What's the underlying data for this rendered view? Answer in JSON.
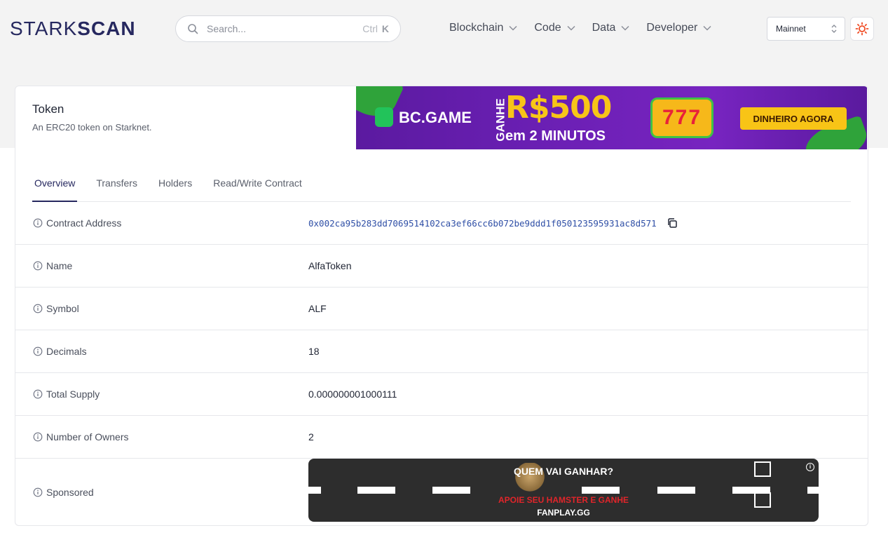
{
  "header": {
    "logo_thin": "STARK",
    "logo_bold": "SCAN",
    "search_placeholder": "Search...",
    "search_shortcut_ctrl": "Ctrl",
    "search_shortcut_key": "K",
    "nav": [
      "Blockchain",
      "Code",
      "Data",
      "Developer"
    ],
    "network": "Mainnet"
  },
  "card": {
    "title": "Token",
    "subtitle": "An ERC20 token on Starknet.",
    "banner": {
      "brand": "BC.GAME",
      "ganhe": "GANHE",
      "amount": "R$500",
      "minutes": "em 2 MINUTOS",
      "slot": "777",
      "cta": "DINHEIRO AGORA"
    },
    "tabs": [
      "Overview",
      "Transfers",
      "Holders",
      "Read/Write Contract"
    ],
    "active_tab": "Overview",
    "rows": {
      "contract_address": {
        "label": "Contract Address",
        "value": "0x002ca95b283dd7069514102ca3ef66cc6b072be9ddd1f050123595931ac8d571"
      },
      "name": {
        "label": "Name",
        "value": "AlfaToken"
      },
      "symbol": {
        "label": "Symbol",
        "value": "ALF"
      },
      "decimals": {
        "label": "Decimals",
        "value": "18"
      },
      "total_supply": {
        "label": "Total Supply",
        "value": "0.000000001000111"
      },
      "owners": {
        "label": "Number of Owners",
        "value": "2"
      },
      "sponsored": {
        "label": "Sponsored"
      }
    },
    "ad": {
      "question": "QUEM VAI GANHAR?",
      "promo": "APOIE SEU HAMSTER E GANHE",
      "brand": "FANPLAY.GG",
      "info": "i"
    }
  },
  "colors": {
    "brand_navy": "#26285f",
    "link_blue": "#2f4fa6",
    "theme_icon": "#f04b23"
  },
  "icons": [
    "search-icon",
    "chevron-down-icon",
    "sort-icon",
    "sun-icon",
    "info-icon",
    "copy-icon"
  ]
}
